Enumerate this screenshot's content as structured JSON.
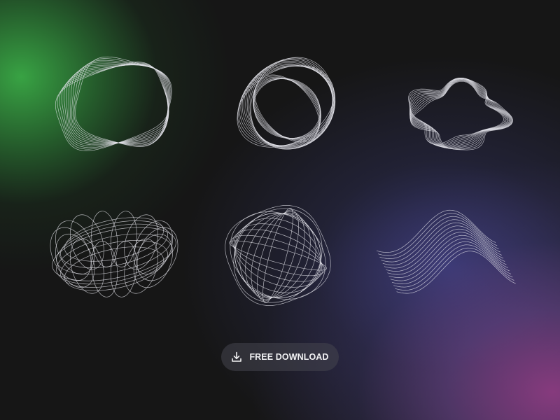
{
  "download_button": {
    "label": "FREE DOWNLOAD",
    "icon": "download-icon"
  },
  "artworks": [
    {
      "name": "wireframe-shape-twisted-ring",
      "icon": "shape-icon"
    },
    {
      "name": "wireframe-shape-loop-ring",
      "icon": "shape-icon"
    },
    {
      "name": "wireframe-shape-wavy-blob",
      "icon": "shape-icon"
    },
    {
      "name": "wireframe-shape-torus",
      "icon": "shape-icon"
    },
    {
      "name": "wireframe-shape-sphere",
      "icon": "shape-icon"
    },
    {
      "name": "wireframe-shape-wave-ribbon",
      "icon": "shape-icon"
    }
  ],
  "colors": {
    "background": "#161616",
    "green_glow": "#3aaa46",
    "purple_glow": "#8c3c82",
    "indigo_glow": "#464696",
    "line": "#e6e6ec",
    "button_bg": "#46464e",
    "button_text": "#f2f2f4"
  }
}
